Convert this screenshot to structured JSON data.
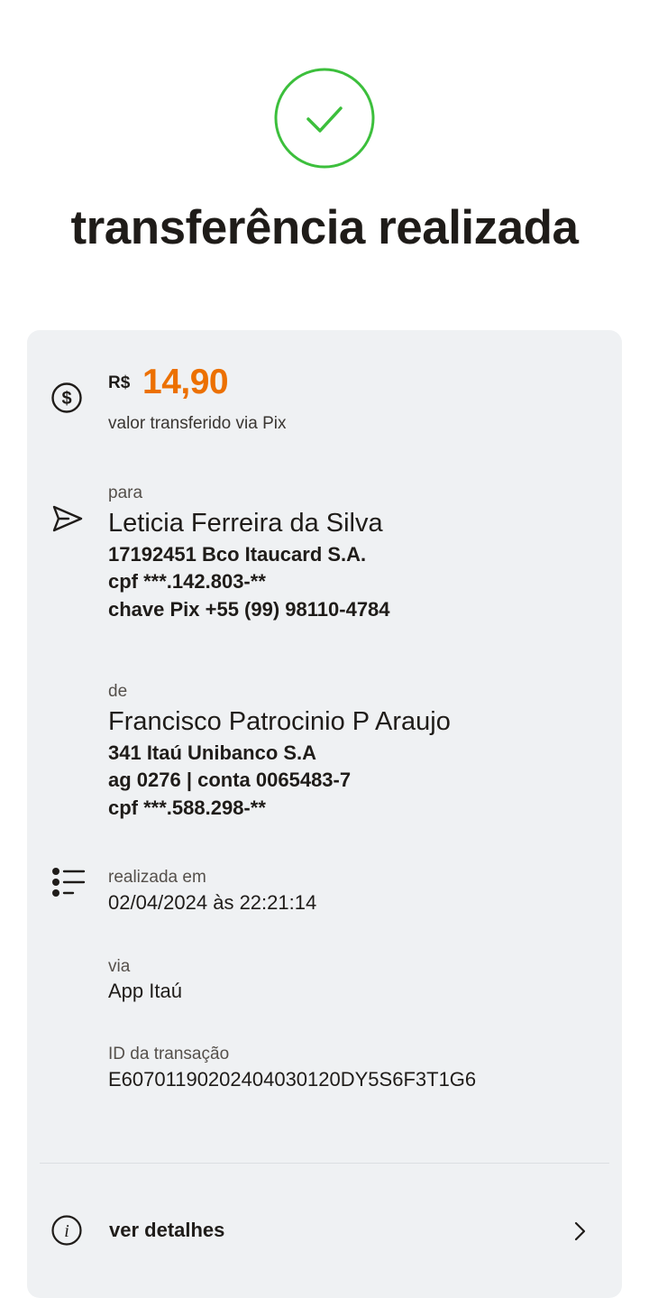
{
  "header": {
    "title": "transferência realizada",
    "success_icon": "check-circle-icon",
    "success_color": "#3cbf3c"
  },
  "amount": {
    "currency": "R$",
    "value": "14,90",
    "caption": "valor transferido via Pix",
    "icon": "dollar-circle-icon",
    "accent_color": "#ec7000"
  },
  "to": {
    "label": "para",
    "icon": "send-icon",
    "name": "Leticia Ferreira da Silva",
    "bank": "17192451 Bco Itaucard S.A.",
    "cpf": "cpf ***.142.803-**",
    "pix_key": "chave Pix +55 (99) 98110-4784"
  },
  "from": {
    "label": "de",
    "name": "Francisco Patrocinio P Araujo",
    "bank": "341 Itaú Unibanco S.A",
    "account": "ag 0276 | conta 0065483-7",
    "cpf": "cpf ***.588.298-**"
  },
  "info": {
    "icon": "list-icon",
    "date_label": "realizada em",
    "date_value": "02/04/2024 às 22:21:14",
    "via_label": "via",
    "via_value": "App Itaú",
    "id_label": "ID da transação",
    "id_value": "E60701190202404030120DY5S6F3T1G6"
  },
  "details": {
    "label": "ver detalhes",
    "icon": "info-icon",
    "chevron": "chevron-right-icon"
  }
}
